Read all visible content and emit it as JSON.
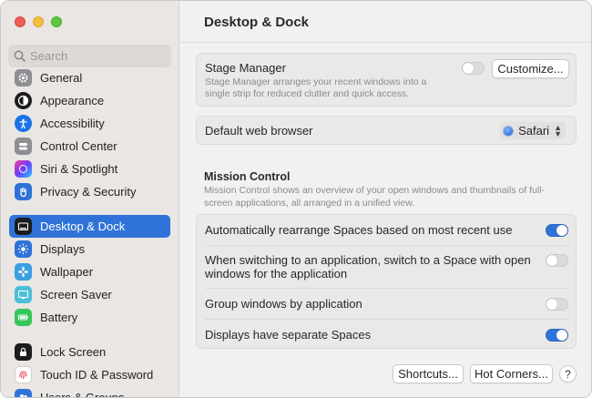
{
  "sidebar": {
    "search_placeholder": "Search",
    "items": [
      {
        "label": "General",
        "icon": "gear-icon",
        "color": "#8e8e93"
      },
      {
        "label": "Appearance",
        "icon": "appearance-icon",
        "color": "#1c1c1e"
      },
      {
        "label": "Accessibility",
        "icon": "accessibility-icon",
        "color": "#1a73e8"
      },
      {
        "label": "Control Center",
        "icon": "control-center-icon",
        "color": "#8e8e93"
      },
      {
        "label": "Siri & Spotlight",
        "icon": "siri-icon",
        "color": "#2b2b6e"
      },
      {
        "label": "Privacy & Security",
        "icon": "hand-icon",
        "color": "#2f73d8"
      },
      {
        "label": "Desktop & Dock",
        "icon": "dock-icon",
        "color": "#1c1c1e"
      },
      {
        "label": "Displays",
        "icon": "displays-icon",
        "color": "#2f73d8"
      },
      {
        "label": "Wallpaper",
        "icon": "wallpaper-icon",
        "color": "#3aa0e0"
      },
      {
        "label": "Screen Saver",
        "icon": "screen-saver-icon",
        "color": "#4cc0d8"
      },
      {
        "label": "Battery",
        "icon": "battery-icon",
        "color": "#34c759"
      },
      {
        "label": "Lock Screen",
        "icon": "lock-icon",
        "color": "#1c1c1e"
      },
      {
        "label": "Touch ID & Password",
        "icon": "fingerprint-icon",
        "color": "#ffffff"
      },
      {
        "label": "Users & Groups",
        "icon": "users-icon",
        "color": "#2f73d8"
      }
    ]
  },
  "main": {
    "title": "Desktop & Dock",
    "stage_manager": {
      "title": "Stage Manager",
      "description_line1": "Stage Manager arranges your recent windows into a",
      "description_line2": "single strip for reduced clutter and quick access.",
      "customize_label": "Customize..."
    },
    "browser": {
      "title": "Default web browser",
      "value": "Safari"
    },
    "mission_control": {
      "title": "Mission Control",
      "description_line1": "Mission Control shows an overview of your open windows and thumbnails of full-",
      "description_line2": "screen applications, all arranged in a unified view.",
      "options": [
        {
          "label": "Automatically rearrange Spaces based on most recent use",
          "on": true
        },
        {
          "label_line1": "When switching to an application, switch to a Space with open",
          "label_line2": "windows for the application",
          "on": false
        },
        {
          "label": "Group windows by application",
          "on": false
        },
        {
          "label": "Displays have separate Spaces",
          "on": true
        }
      ]
    },
    "footer": {
      "shortcuts_label": "Shortcuts...",
      "hot_corners_label": "Hot Corners...",
      "help_label": "?"
    }
  },
  "colors": {
    "accent": "#2f73d8",
    "sidebar_bg": "#e9e6e3",
    "main_bg": "#f2f1f0"
  }
}
